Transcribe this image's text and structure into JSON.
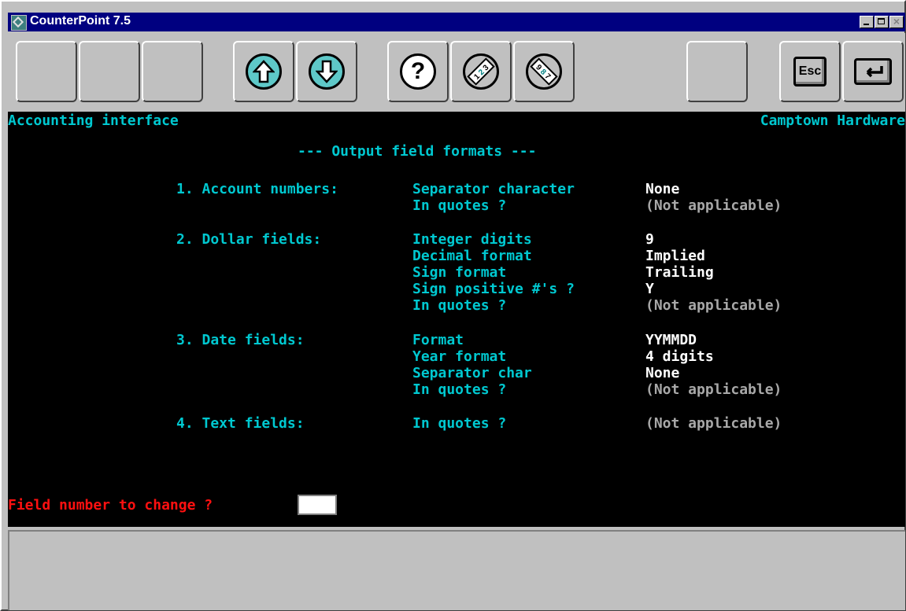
{
  "window": {
    "title": "CounterPoint 7.5"
  },
  "toolbar": {
    "esc_label": "Esc"
  },
  "header": {
    "left": "Accounting interface",
    "right": "Camptown Hardware"
  },
  "screen_title": "--- Output field formats ---",
  "sections": [
    {
      "label": "1. Account numbers:",
      "rows": [
        {
          "name": "Separator character",
          "value": "None"
        },
        {
          "name": "In quotes ?",
          "value": "(Not applicable)"
        }
      ]
    },
    {
      "label": "2. Dollar fields:",
      "rows": [
        {
          "name": "Integer digits",
          "value": "9"
        },
        {
          "name": "Decimal format",
          "value": "Implied"
        },
        {
          "name": "Sign format",
          "value": "Trailing"
        },
        {
          "name": "Sign positive #'s ?",
          "value": "Y"
        },
        {
          "name": "In quotes ?",
          "value": "(Not applicable)"
        }
      ]
    },
    {
      "label": "3. Date fields:",
      "rows": [
        {
          "name": "Format",
          "value": "YYMMDD"
        },
        {
          "name": "Year format",
          "value": "4 digits"
        },
        {
          "name": "Separator char",
          "value": "None"
        },
        {
          "name": "In quotes ?",
          "value": "(Not applicable)"
        }
      ]
    },
    {
      "label": "4. Text fields:",
      "rows": [
        {
          "name": "In quotes ?",
          "value": "(Not applicable)"
        }
      ]
    }
  ],
  "prompt": {
    "label": "Field number to change ?",
    "value": ""
  }
}
